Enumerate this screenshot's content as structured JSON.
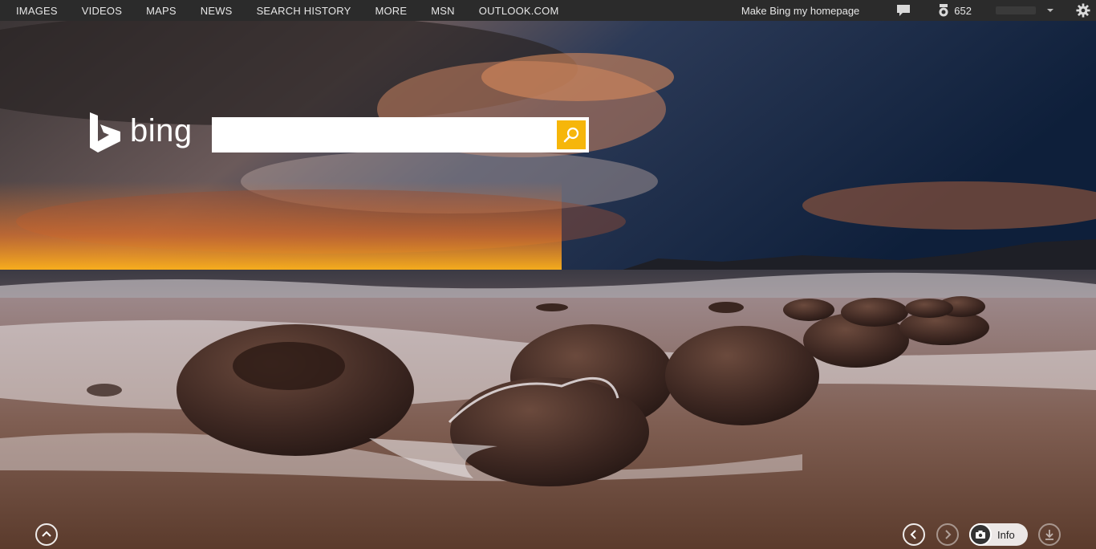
{
  "nav": {
    "links": [
      "IMAGES",
      "VIDEOS",
      "MAPS",
      "NEWS",
      "SEARCH HISTORY",
      "MORE",
      "MSN",
      "OUTLOOK.COM"
    ],
    "make_homepage": "Make Bing my homepage",
    "rewards_count": "652"
  },
  "logo": {
    "text": "bing"
  },
  "search": {
    "value": "",
    "placeholder": ""
  },
  "footer": {
    "info_label": "Info"
  },
  "colors": {
    "topbar": "#2b2b2b",
    "search_button": "#f6b60a",
    "text": "#e6e6e6"
  },
  "icons": [
    "feedback-icon",
    "rewards-icon",
    "chevron-down-icon",
    "gear-icon",
    "bing-logo-icon",
    "search-icon",
    "chevron-up-icon",
    "chevron-left-icon",
    "chevron-right-icon",
    "camera-icon",
    "download-icon"
  ]
}
